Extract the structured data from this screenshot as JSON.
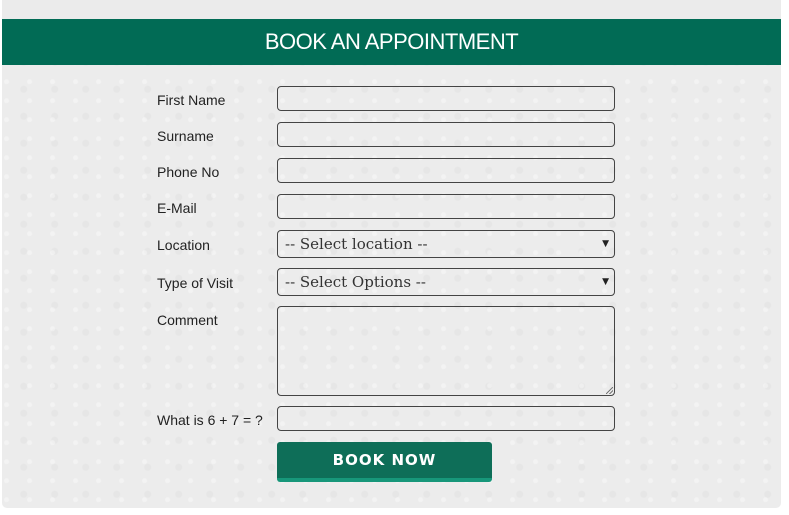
{
  "header": {
    "title": "BOOK AN APPOINTMENT"
  },
  "colors": {
    "header_bg": "#016b55",
    "button_bg": "#0e6e58",
    "button_border": "#17977a",
    "panel_bg": "#ececec"
  },
  "form": {
    "first_name": {
      "label": "First Name",
      "value": ""
    },
    "surname": {
      "label": "Surname",
      "value": ""
    },
    "phone": {
      "label": "Phone No",
      "value": ""
    },
    "email": {
      "label": "E-Mail",
      "value": ""
    },
    "location": {
      "label": "Location",
      "selected": "-- Select location --",
      "icon": "triangle-down"
    },
    "visit_type": {
      "label": "Type of Visit",
      "selected": "-- Select Options --",
      "icon": "triangle-down"
    },
    "comment": {
      "label": "Comment",
      "value": ""
    },
    "captcha": {
      "label": "What is 6 + 7 = ?",
      "value": ""
    },
    "submit_label": "BOOK NOW"
  }
}
